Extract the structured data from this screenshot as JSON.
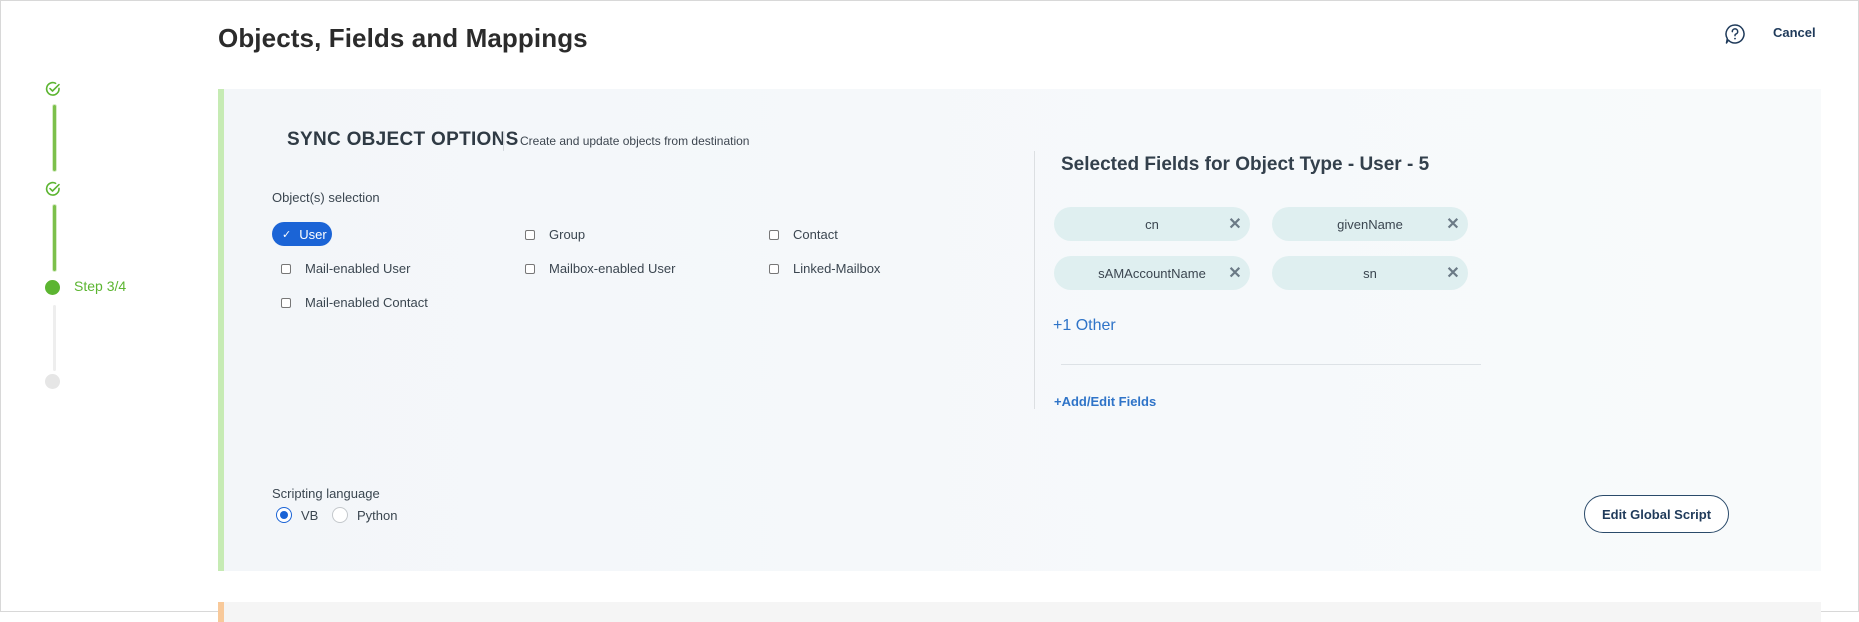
{
  "header": {
    "title": "Objects, Fields and Mappings",
    "cancel_label": "Cancel",
    "help_icon": "question-bubble-icon"
  },
  "stepper": {
    "current_label": "Step 3/4",
    "steps": [
      "complete",
      "complete",
      "current",
      "pending"
    ]
  },
  "sync_section": {
    "title": "SYNC OBJECT OPTIONS",
    "description": "Create and update objects from destination",
    "objects_label": "Object(s) selection",
    "objects": [
      {
        "label": "User",
        "checked": true
      },
      {
        "label": "Group",
        "checked": false
      },
      {
        "label": "Contact",
        "checked": false
      },
      {
        "label": "Mail-enabled User",
        "checked": false
      },
      {
        "label": "Mailbox-enabled User",
        "checked": false
      },
      {
        "label": "Linked-Mailbox",
        "checked": false
      },
      {
        "label": "Mail-enabled Contact",
        "checked": false
      }
    ],
    "scripting_label": "Scripting language",
    "scripting_options": [
      {
        "label": "VB",
        "selected": true
      },
      {
        "label": "Python",
        "selected": false
      }
    ],
    "edit_script_label": "Edit Global Script"
  },
  "fields_section": {
    "title": "Selected Fields for Object Type - User - 5",
    "fields": [
      "cn",
      "givenName",
      "sAMAccountName",
      "sn"
    ],
    "remove_symbol": "✕",
    "more_label": "+1 Other",
    "add_edit_label": "+Add/Edit Fields"
  },
  "colors": {
    "accent": "#1b64d6",
    "success": "#5cb531",
    "link": "#2f74c8",
    "panel_bar": "#c6ebb4",
    "next_panel_bar": "#f8c99a"
  }
}
